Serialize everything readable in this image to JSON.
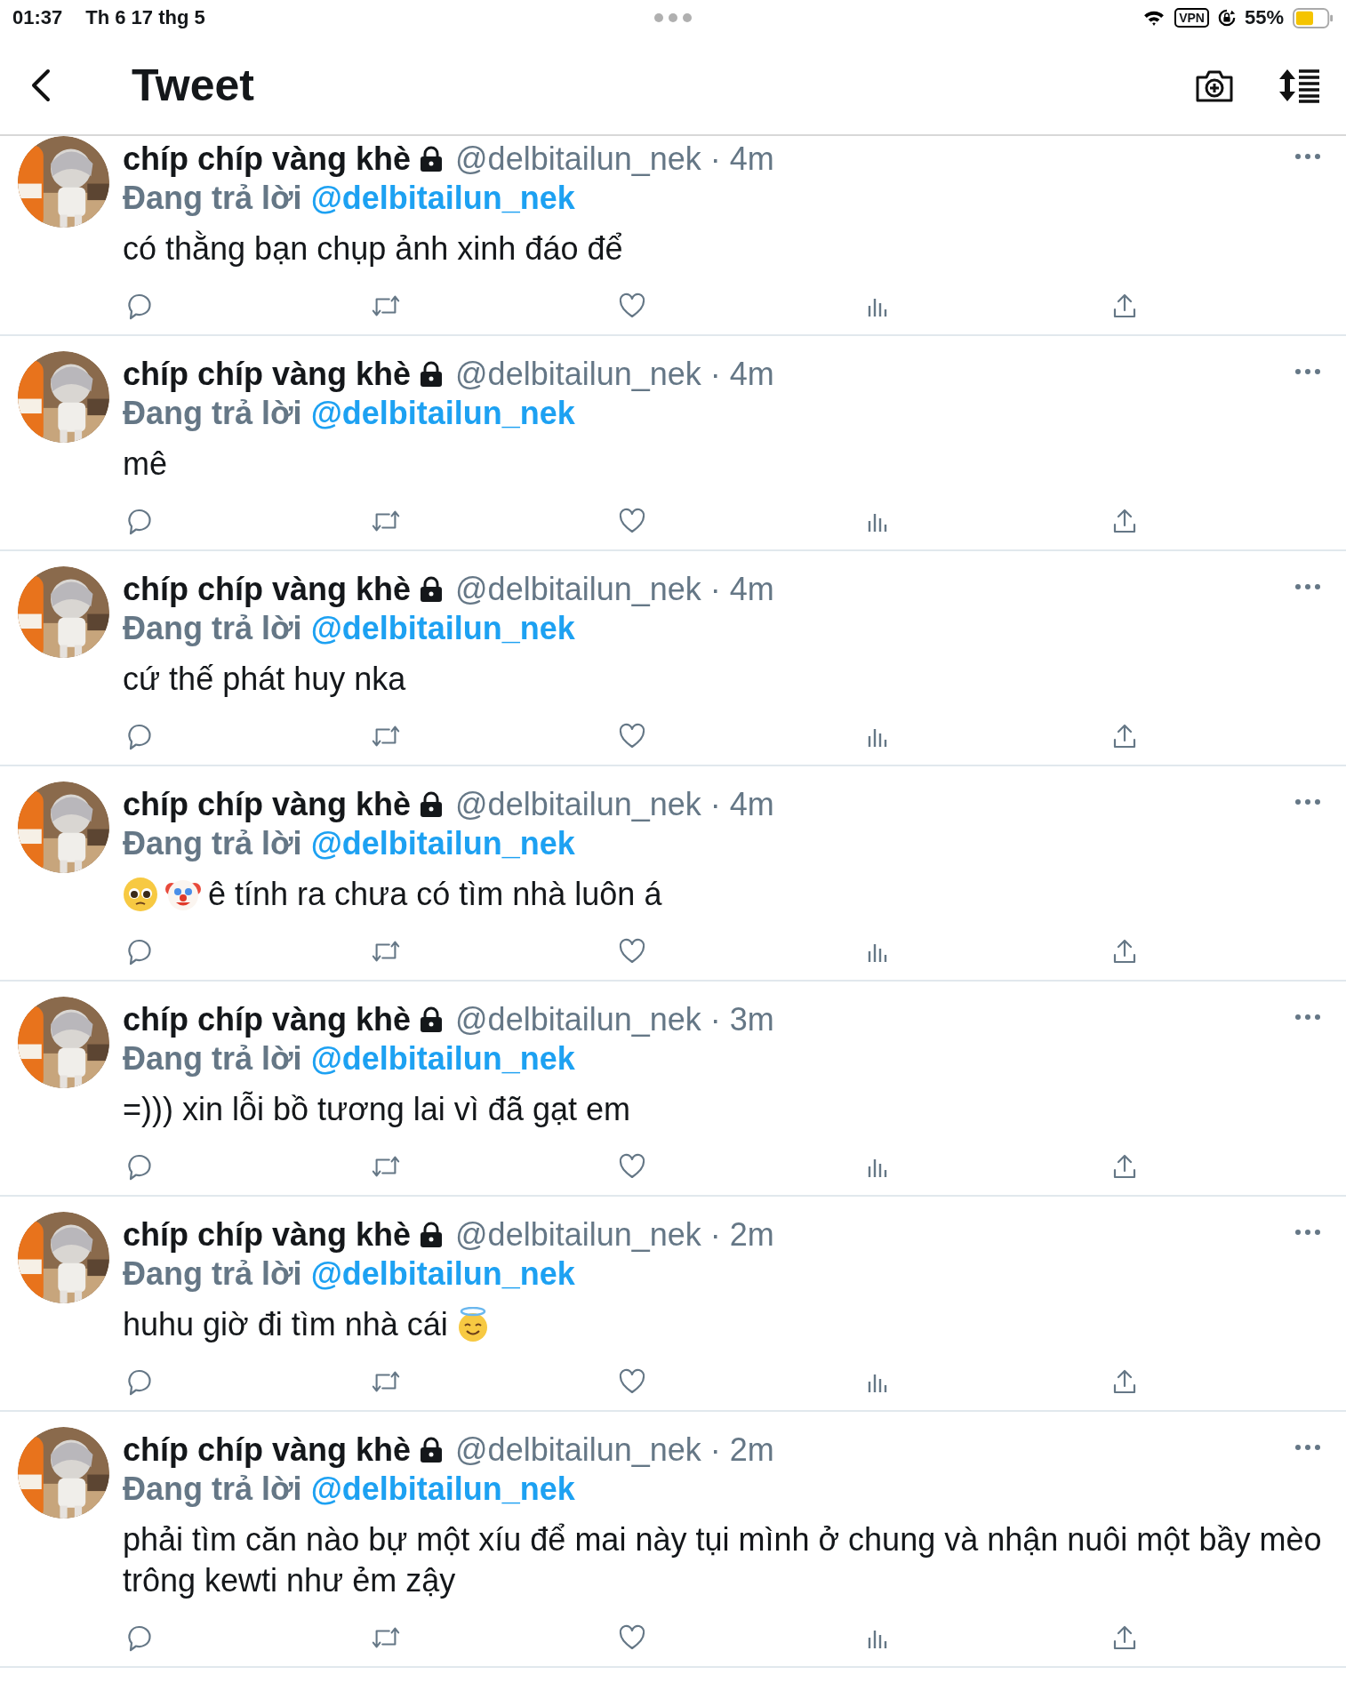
{
  "status_bar": {
    "time": "01:37",
    "date": "Th 6 17 thg 5",
    "vpn": "VPN",
    "battery": "55%"
  },
  "header": {
    "title": "Tweet"
  },
  "tweets": [
    {
      "name": "chíp chíp vàng khè",
      "meta": "@delbitailun_nek · 4m",
      "reply_label": "Đang trả lời",
      "reply_to": "@delbitailun_nek",
      "content": [
        {
          "kind": "text",
          "text": "có thằng bạn chụp ảnh xinh đáo để"
        }
      ]
    },
    {
      "name": "chíp chíp vàng khè",
      "meta": "@delbitailun_nek · 4m",
      "reply_label": "Đang trả lời",
      "reply_to": "@delbitailun_nek",
      "content": [
        {
          "kind": "text",
          "text": "mê"
        }
      ]
    },
    {
      "name": "chíp chíp vàng khè",
      "meta": "@delbitailun_nek · 4m",
      "reply_label": "Đang trả lời",
      "reply_to": "@delbitailun_nek",
      "content": [
        {
          "kind": "text",
          "text": "cứ thế phát huy nka"
        }
      ]
    },
    {
      "name": "chíp chíp vàng khè",
      "meta": "@delbitailun_nek · 4m",
      "reply_label": "Đang trả lời",
      "reply_to": "@delbitailun_nek",
      "content": [
        {
          "kind": "pleading"
        },
        {
          "kind": "clown"
        },
        {
          "kind": "text",
          "text": "ê tính ra chưa có tìm nhà luôn á"
        }
      ]
    },
    {
      "name": "chíp chíp vàng khè",
      "meta": "@delbitailun_nek · 3m",
      "reply_label": "Đang trả lời",
      "reply_to": "@delbitailun_nek",
      "content": [
        {
          "kind": "text",
          "text": "=))) xin lỗi bồ tương lai vì đã gạt em"
        }
      ]
    },
    {
      "name": "chíp chíp vàng khè",
      "meta": "@delbitailun_nek · 2m",
      "reply_label": "Đang trả lời",
      "reply_to": "@delbitailun_nek",
      "content": [
        {
          "kind": "text",
          "text": "huhu giờ đi tìm nhà cái"
        },
        {
          "kind": "halo"
        }
      ]
    },
    {
      "name": "chíp chíp vàng khè",
      "meta": "@delbitailun_nek · 2m",
      "reply_label": "Đang trả lời",
      "reply_to": "@delbitailun_nek",
      "content": [
        {
          "kind": "text",
          "text": "phải tìm căn nào bự một xíu để mai này tụi mình ở chung và nhận nuôi một bầy mèo trông kewti như ẻm zậy"
        }
      ]
    }
  ]
}
